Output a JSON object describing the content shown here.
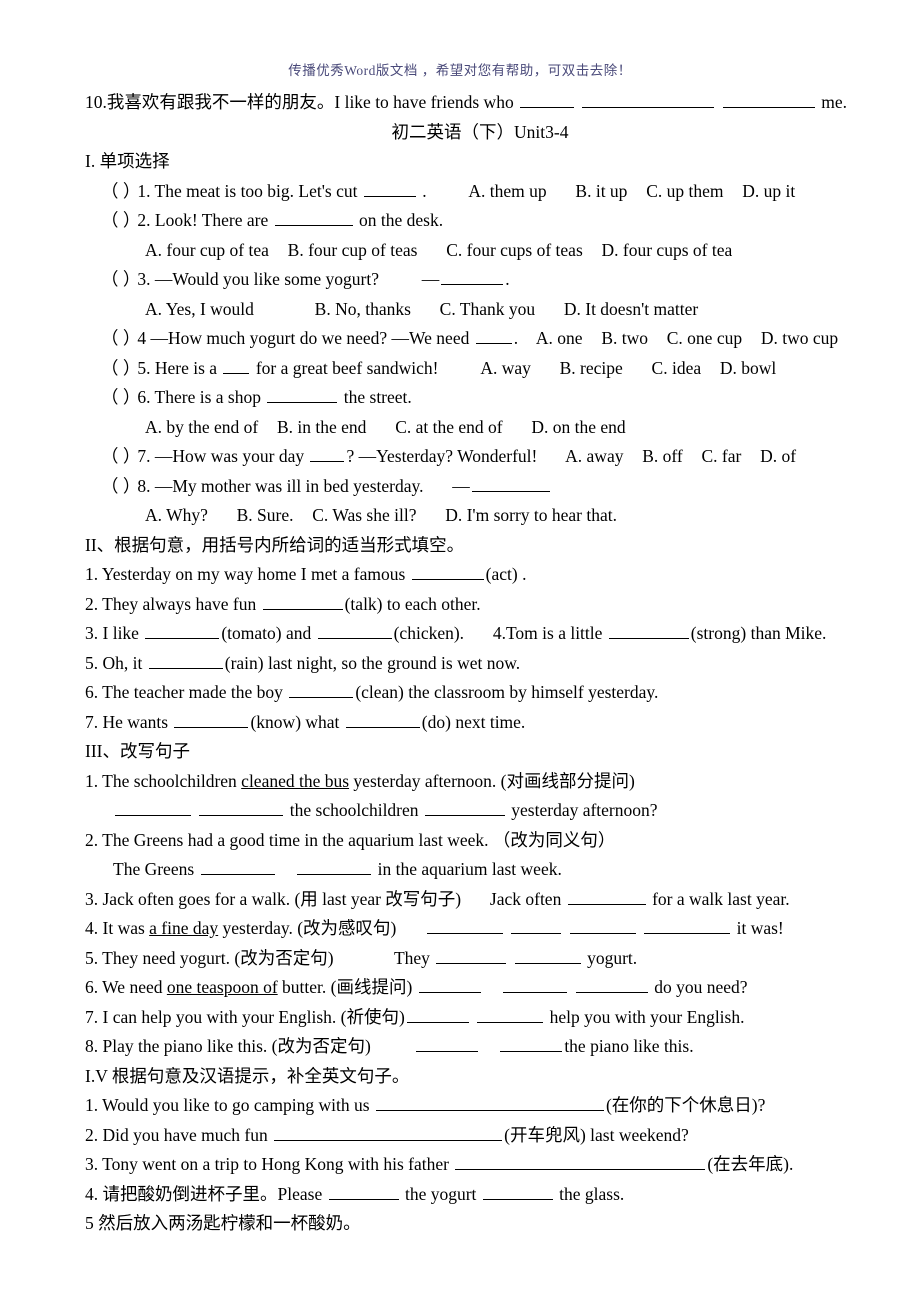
{
  "watermark": "传播优秀Word版文档 ，希望对您有帮助，可双击去除！",
  "top_line": {
    "prefix": "10.我喜欢有跟我不一样的朋友。I like to have friends who",
    "suffix": "me."
  },
  "title": "初二英语（下）Unit3-4",
  "sections": {
    "s1": {
      "heading": "I. 单项选择",
      "items": [
        {
          "paren": "（  ）",
          "stem_a": "1. The meat is too big. Let's cut",
          "stem_b": ".",
          "options": [
            "A. them up",
            "B. it up",
            "C. up them",
            "D. up it"
          ]
        },
        {
          "paren": "（  ）",
          "stem_a": "2. Look! There are",
          "stem_b": "on the desk.",
          "options_line": "A. four cup of tea   B. four cup of teas    C. four cups of teas   D. four cups of tea",
          "options": [
            "A. four cup of tea",
            "B. four cup of teas",
            "C. four cups of teas",
            "D. four cups of tea"
          ]
        },
        {
          "paren": "（  ）",
          "stem_a": "3. —Would you like some yogurt?",
          "stem_b": "—",
          "stem_c": ".",
          "options": [
            "A. Yes, I would",
            "B. No, thanks",
            "C. Thank you",
            "D. It doesn't matter"
          ]
        },
        {
          "paren": "（  ）",
          "stem_a": "4 —How much yogurt do we need? —We need",
          "stem_b": ".",
          "options": [
            "A. one",
            "B. two",
            "C. one cup",
            "D. two cup"
          ]
        },
        {
          "paren": "（  ）",
          "stem_a": "5. Here is a",
          "stem_b": "for a great beef sandwich!",
          "options": [
            "A. way",
            "B. recipe",
            "C. idea",
            "D. bowl"
          ]
        },
        {
          "paren": "（  ）",
          "stem_a": "6. There is a shop",
          "stem_b": "the street.",
          "options": [
            "A. by the end of",
            "B. in the end",
            "C. at the end of",
            "D. on the end"
          ]
        },
        {
          "paren": "（  ）",
          "stem_a": "7. —How was your day",
          "stem_b": "?   —Yesterday? Wonderful!",
          "options": [
            "A. away",
            "B. off",
            "C. far",
            "D. of"
          ]
        },
        {
          "paren": "（  ）",
          "stem_a": "8. —My mother was ill in bed yesterday.",
          "stem_b": "—",
          "options": [
            "A. Why?",
            "B. Sure.",
            "C. Was she ill?",
            "D. I'm sorry to hear that."
          ]
        }
      ]
    },
    "s2": {
      "heading": "II、根据句意，用括号内所给词的适当形式填空。",
      "q1_a": "1. Yesterday on my way home I met a famous",
      "q1_b": "(act) .",
      "q2_a": "2. They always have fun",
      "q2_b": "(talk) to each other.",
      "q3_a": "3. I like",
      "q3_b": "(tomato) and",
      "q3_c": "(chicken).",
      "q3_d": "4.Tom is a little",
      "q3_e": "(strong) than Mike.",
      "q5_a": "5. Oh, it",
      "q5_b": "(rain) last night, so the ground is wet now.",
      "q6_a": "6. The teacher made the boy",
      "q6_b": "(clean) the classroom by himself yesterday.",
      "q7_a": "7. He wants",
      "q7_b": "(know) what",
      "q7_c": "(do) next time."
    },
    "s3": {
      "heading": "III、改写句子",
      "q1_a": "1. The schoolchildren ",
      "q1_underlined": "cleaned the bus",
      "q1_b": " yesterday afternoon. (对画线部分提问)",
      "q1_ans_a": "the schoolchildren",
      "q1_ans_b": "yesterday afternoon?",
      "q2_a": "2. The Greens had a good time in the aquarium last week. （改为同义句）",
      "q2_ans_a": "The Greens",
      "q2_ans_b": "in the aquarium last week.",
      "q3_a": "3. Jack often goes for a walk. (用 last year 改写句子)",
      "q3_b": "Jack often",
      "q3_c": "for a walk last year.",
      "q4_a": "4. It was ",
      "q4_underlined": "a fine day",
      "q4_b": " yesterday. (改为感叹句)",
      "q4_c": "it was!",
      "q5_a": "5. They need yogurt. (改为否定句)",
      "q5_b": "They",
      "q5_c": "yogurt.",
      "q6_a": "6. We need ",
      "q6_underlined": "one teaspoon of",
      "q6_b": " butter. (画线提问)",
      "q6_c": "do you need?",
      "q7_a": "7. I can help you with your English. (祈使句)",
      "q7_b": "help you with your English.",
      "q8_a": "8. Play the piano like this. (改为否定句)",
      "q8_b": "the piano like this."
    },
    "s4": {
      "heading": "I.V 根据句意及汉语提示，补全英文句子。",
      "q1_a": "1. Would you like to go camping with us",
      "q1_b": "(在你的下个休息日)?",
      "q2_a": "2. Did you have much fun",
      "q2_b": "(开车兜风) last weekend?",
      "q3_a": "3. Tony went on a trip to Hong Kong with his father",
      "q3_b": "(在去年底).",
      "q4_a": "4. 请把酸奶倒进杯子里。Please",
      "q4_b": "the yogurt",
      "q4_c": "the glass.",
      "q5_a": "5 然后放入两汤匙柠檬和一杯酸奶。"
    }
  }
}
